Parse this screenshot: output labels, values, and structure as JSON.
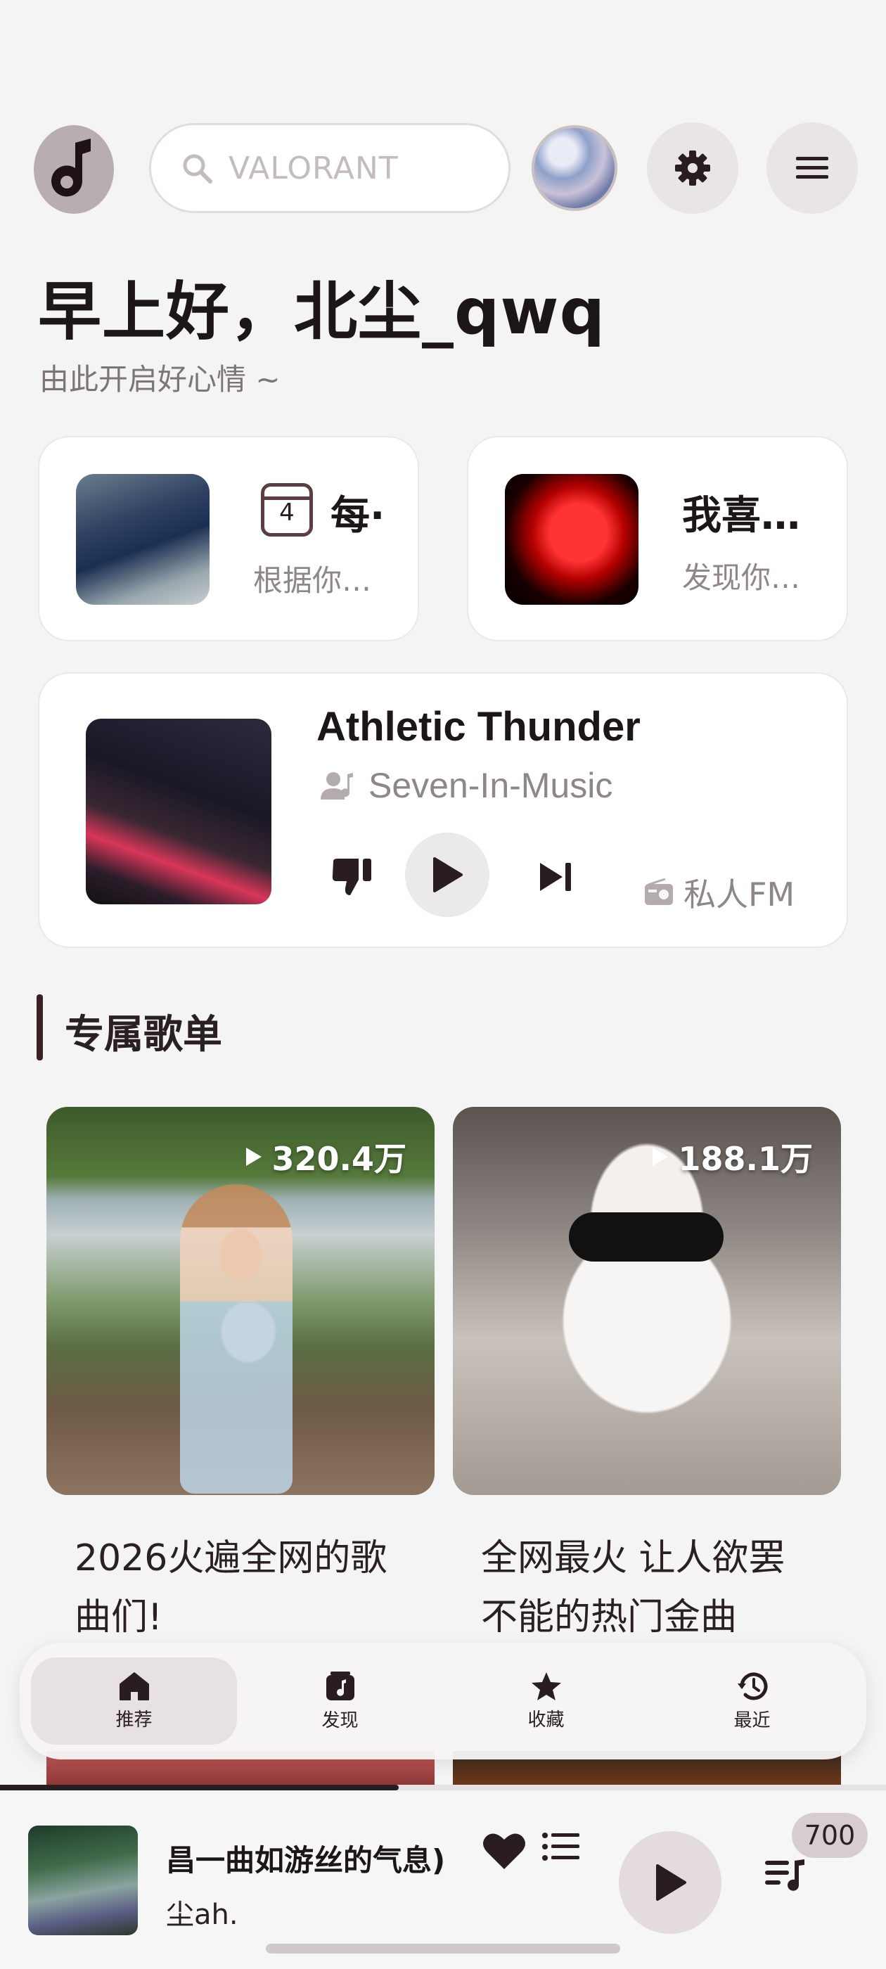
{
  "header": {
    "search_placeholder": "VALORANT",
    "icons": [
      "music-note-icon",
      "search-icon",
      "gear-icon",
      "hamburger-icon"
    ]
  },
  "greeting": {
    "title": "早上好，北尘_qwq",
    "subtitle": "由此开启好心情 ~"
  },
  "quick_cards": {
    "daily": {
      "day": "4",
      "title": "每·",
      "subtitle": "根据你…"
    },
    "liked": {
      "title": "我喜…",
      "subtitle": "发现你…"
    }
  },
  "fm": {
    "song": "Athletic Thunder",
    "artist": "Seven-In-Music",
    "label": "私人FM"
  },
  "section": {
    "title": "专属歌单"
  },
  "playlists": [
    {
      "play_count": "320.4万",
      "name": "2026火遍全网的歌曲们!"
    },
    {
      "play_count": "188.1万",
      "name": "全网最火 让人欲罢不能的热门金曲"
    }
  ],
  "nav": {
    "items": [
      {
        "label": "推荐",
        "active": true
      },
      {
        "label": "发现",
        "active": false
      },
      {
        "label": "收藏",
        "active": false
      },
      {
        "label": "最近",
        "active": false
      }
    ]
  },
  "player": {
    "song": "昌一曲如游丝的气息)",
    "artist": "尘ah.",
    "queue_count": "700",
    "progress_fraction": 0.45
  },
  "colors": {
    "background": "#f5f4f5",
    "accent_dark": "#2a1d20",
    "logo_bg": "#b8aeb0",
    "muted_text": "#8f8689"
  }
}
